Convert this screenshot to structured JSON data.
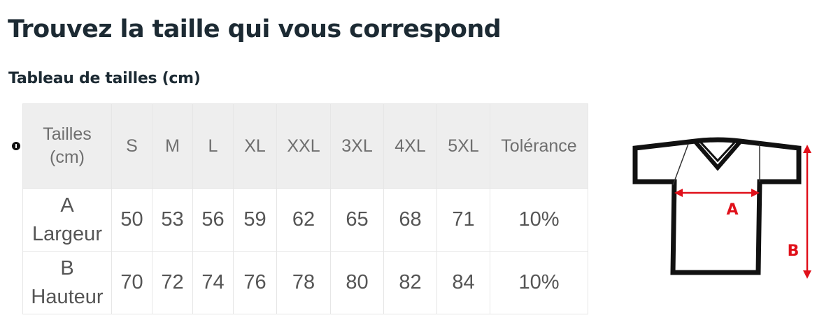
{
  "page": {
    "title": "Trouvez la taille qui vous correspond",
    "section_title": "Tableau de tailles (cm)"
  },
  "size_table": {
    "header_label_line1": "Tailles",
    "header_label_line2": "(cm)",
    "sizes": [
      "S",
      "M",
      "L",
      "XL",
      "XXL",
      "3XL",
      "4XL",
      "5XL"
    ],
    "tolerance_header": "Tolérance",
    "rows": [
      {
        "code": "A",
        "name": "Largeur",
        "values": [
          "50",
          "53",
          "56",
          "59",
          "62",
          "65",
          "68",
          "71"
        ],
        "tolerance": "10%"
      },
      {
        "code": "B",
        "name": "Hauteur",
        "values": [
          "70",
          "72",
          "74",
          "76",
          "78",
          "80",
          "82",
          "84"
        ],
        "tolerance": "10%"
      }
    ]
  },
  "diagram": {
    "label_a": "A",
    "label_b": "B",
    "accent_color": "#e0101a",
    "outline_color": "#111111"
  },
  "icons": {
    "row_marker": "info-dot-icon"
  }
}
